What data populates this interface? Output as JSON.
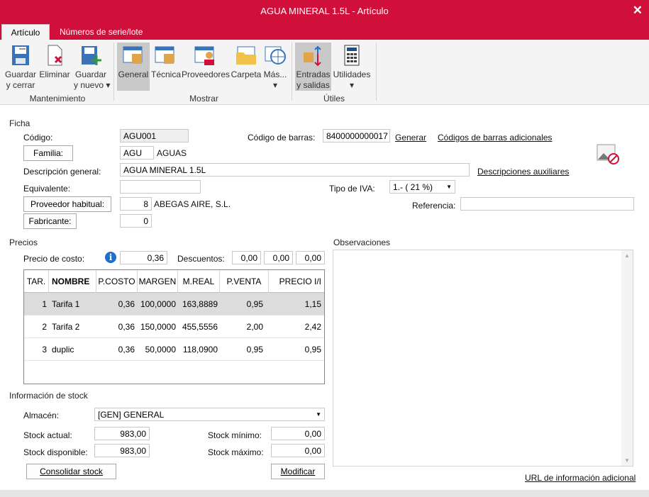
{
  "window": {
    "title": "AGUA MINERAL 1.5L - Artículo",
    "close_icon": "close-icon"
  },
  "tabs": [
    {
      "label": "Artículo"
    },
    {
      "label": "Números de serie/lote"
    }
  ],
  "ribbon": {
    "buttons": [
      {
        "line1": "Guardar",
        "line2": "y cerrar"
      },
      {
        "line1": "Eliminar",
        "line2": ""
      },
      {
        "line1": "Guardar",
        "line2": "y nuevo ▾"
      },
      {
        "line1": "General",
        "line2": ""
      },
      {
        "line1": "Técnica",
        "line2": ""
      },
      {
        "line1": "Proveedores",
        "line2": ""
      },
      {
        "line1": "Carpeta",
        "line2": ""
      },
      {
        "line1": "Más...",
        "line2": "▾"
      },
      {
        "line1": "Entradas",
        "line2": "y salidas"
      },
      {
        "line1": "Utilidades",
        "line2": "▾"
      }
    ],
    "groups": [
      "Mantenimiento",
      "Mostrar",
      "Útiles"
    ]
  },
  "ficha": {
    "section": "Ficha",
    "codigo_label": "Código:",
    "codigo": "AGU001",
    "familia_button": "Familia:",
    "familia_code": "AGU",
    "familia_name": "AGUAS",
    "descripcion_label": "Descripción general:",
    "descripcion": "AGUA MINERAL 1.5L",
    "equivalente_label": "Equivalente:",
    "equivalente": "",
    "proveedor_button": "Proveedor habitual:",
    "proveedor_code": "8",
    "proveedor_name": "ABEGAS AIRE, S.L.",
    "fabricante_button": "Fabricante:",
    "fabricante": "0",
    "barras_label": "Código de barras:",
    "barras": "8400000000017",
    "generar_link": "Generar",
    "barras_adicionales_link": "Códigos de barras adicionales",
    "descripciones_link": "Descripciones auxiliares",
    "iva_label": "Tipo de IVA:",
    "iva": "1.- ( 21 %)",
    "referencia_label": "Referencia:",
    "referencia": ""
  },
  "precios": {
    "section": "Precios",
    "costo_label": "Precio de costo:",
    "costo": "0,36",
    "descuentos_label": "Descuentos:",
    "descuentos": [
      "0,00",
      "0,00",
      "0,00"
    ],
    "columns": [
      "TAR.",
      "NOMBRE",
      "P.COSTO",
      "MARGEN",
      "M.REAL",
      "P.VENTA",
      "PRECIO I/I"
    ],
    "rows": [
      [
        "1",
        "Tarifa 1",
        "0,36",
        "100,0000",
        "163,8889",
        "0,95",
        "1,15"
      ],
      [
        "2",
        "Tarifa 2",
        "0,36",
        "150,0000",
        "455,5556",
        "2,00",
        "2,42"
      ],
      [
        "3",
        "duplic",
        "0,36",
        "50,0000",
        "118,0900",
        "0,95",
        "0,95"
      ]
    ]
  },
  "observaciones": {
    "section": "Observaciones",
    "text": ""
  },
  "stock": {
    "section": "Información de stock",
    "almacen_label": "Almacén:",
    "almacen": "[GEN] GENERAL",
    "actual_label": "Stock actual:",
    "actual": "983,00",
    "disponible_label": "Stock disponible:",
    "disponible": "983,00",
    "minimo_label": "Stock mínimo:",
    "minimo": "0,00",
    "maximo_label": "Stock máximo:",
    "maximo": "0,00",
    "consolidar_button": "Consolidar stock",
    "modificar_button": "Modificar"
  },
  "url_link": "URL de información adicional",
  "colors": {
    "accent": "#d0103a",
    "ribbon_bg": "#f4f4f4",
    "selected_row": "#dcdcdc"
  }
}
